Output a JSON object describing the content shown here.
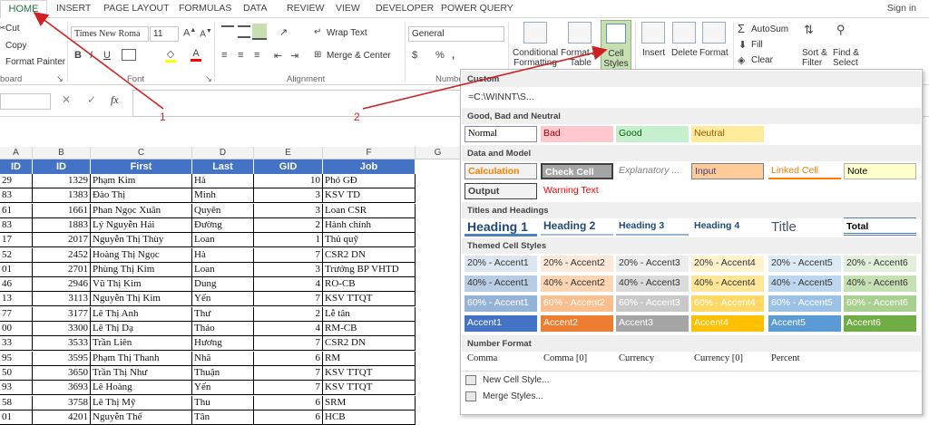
{
  "tabs": [
    "HOME",
    "INSERT",
    "PAGE LAYOUT",
    "FORMULAS",
    "DATA",
    "REVIEW",
    "VIEW",
    "DEVELOPER",
    "POWER QUERY"
  ],
  "signin": "Sign in",
  "clipboard": {
    "cut": "Cut",
    "copy": "Copy",
    "format_painter": "Format Painter",
    "label": "board"
  },
  "font": {
    "name": "Times New Roma",
    "size": "11",
    "label": "Font"
  },
  "alignment": {
    "wrap": "Wrap Text",
    "merge": "Merge & Center",
    "label": "Alignment"
  },
  "number": {
    "format": "General",
    "label": "Numbe"
  },
  "styles": {
    "conditional": [
      "Conditional",
      "Formatting"
    ],
    "format_as": [
      "Format as",
      "Table"
    ],
    "cell_styles": [
      "Cell",
      "Styles"
    ]
  },
  "cells": {
    "insert": "Insert",
    "delete": "Delete",
    "format": "Format"
  },
  "editing": {
    "autosum": "AutoSum",
    "fill": "Fill",
    "clear": "Clear",
    "sort": [
      "Sort &",
      "Filter"
    ],
    "find": [
      "Find &",
      "Select"
    ]
  },
  "formula_bar": {
    "fx": "fx",
    "name_box": ""
  },
  "grid": {
    "col_letters": [
      "A",
      "B",
      "C",
      "D",
      "E",
      "F",
      "G"
    ],
    "headers": [
      "ID",
      "ID",
      "First",
      "Last",
      "GID",
      "Job"
    ],
    "rows": [
      [
        "29",
        "1329",
        "Phạm Kim",
        "Hà",
        "10",
        "Phó GĐ"
      ],
      [
        "83",
        "1383",
        "Đào Thị",
        "Minh",
        "3",
        "KSV TD"
      ],
      [
        "61",
        "1661",
        "Phan Ngọc Xuân",
        "Quyên",
        "3",
        "Loan CSR"
      ],
      [
        "83",
        "1883",
        "Lý Nguyễn Hải",
        "Đường",
        "2",
        "Hành chính"
      ],
      [
        "17",
        "2017",
        "Nguyễn Thị Thùy",
        "Loan",
        "1",
        "Thủ quỹ"
      ],
      [
        "52",
        "2452",
        "Hoàng Thị Ngọc",
        "Hà",
        "7",
        "CSR2 DN"
      ],
      [
        "01",
        "2701",
        "Phùng Thị Kim",
        "Loan",
        "3",
        "Trưởng BP VHTD"
      ],
      [
        "46",
        "2946",
        "Vũ Thị Kim",
        "Dung",
        "4",
        "RO-CB"
      ],
      [
        "13",
        "3113",
        "Nguyễn Thị Kim",
        "Yến",
        "7",
        "KSV TTQT"
      ],
      [
        "77",
        "3177",
        "Lê Thị Anh",
        "Thư",
        "2",
        "Lễ tân"
      ],
      [
        "00",
        "3300",
        "Lê Thị Dạ",
        "Thảo",
        "4",
        "RM-CB"
      ],
      [
        "33",
        "3533",
        "Trần Liên",
        "Hương",
        "7",
        "CSR2 DN"
      ],
      [
        "95",
        "3595",
        "Phạm Thị Thanh",
        "Nhã",
        "6",
        "RM"
      ],
      [
        "50",
        "3650",
        "Trần Thị Như",
        "Thuận",
        "7",
        "KSV TTQT"
      ],
      [
        "93",
        "3693",
        "Lê Hoàng",
        "Yến",
        "7",
        "KSV TTQT"
      ],
      [
        "58",
        "3758",
        "Lê Thị Mỹ",
        "Thu",
        "6",
        "SRM"
      ],
      [
        "01",
        "4201",
        "Nguyễn Thế",
        "Tân",
        "6",
        "HCB"
      ]
    ]
  },
  "gallery": {
    "custom_label": "Custom",
    "custom_value": "=C:\\WINNT\\S...",
    "gbn_label": "Good, Bad and Neutral",
    "gbn": [
      "Normal",
      "Bad",
      "Good",
      "Neutral"
    ],
    "dm_label": "Data and Model",
    "dm": [
      "Calculation",
      "Check Cell",
      "Explanatory ...",
      "Input",
      "Linked Cell",
      "Note",
      "Output",
      "Warning Text"
    ],
    "th_label": "Titles and Headings",
    "th": [
      "Heading 1",
      "Heading 2",
      "Heading 3",
      "Heading 4",
      "Title",
      "Total"
    ],
    "theme_label": "Themed Cell Styles",
    "theme_rows": [
      [
        "20% - Accent1",
        "20% - Accent2",
        "20% - Accent3",
        "20% - Accent4",
        "20% - Accent5",
        "20% - Accent6"
      ],
      [
        "40% - Accent1",
        "40% - Accent2",
        "40% - Accent3",
        "40% - Accent4",
        "40% - Accent5",
        "40% - Accent6"
      ],
      [
        "60% - Accent1",
        "60% - Accent2",
        "60% - Accent3",
        "60% - Accent4",
        "60% - Accent5",
        "60% - Accent6"
      ],
      [
        "Accent1",
        "Accent2",
        "Accent3",
        "Accent4",
        "Accent5",
        "Accent6"
      ]
    ],
    "nf_label": "Number Format",
    "nf": [
      "Comma",
      "Comma [0]",
      "Currency",
      "Currency [0]",
      "Percent"
    ],
    "menu": [
      "New Cell Style...",
      "Merge Styles..."
    ]
  },
  "annotations": [
    "1",
    "2"
  ],
  "colors": {
    "accent": "#217346",
    "header_blue": "#4472c4",
    "arrow": "#d02020"
  }
}
